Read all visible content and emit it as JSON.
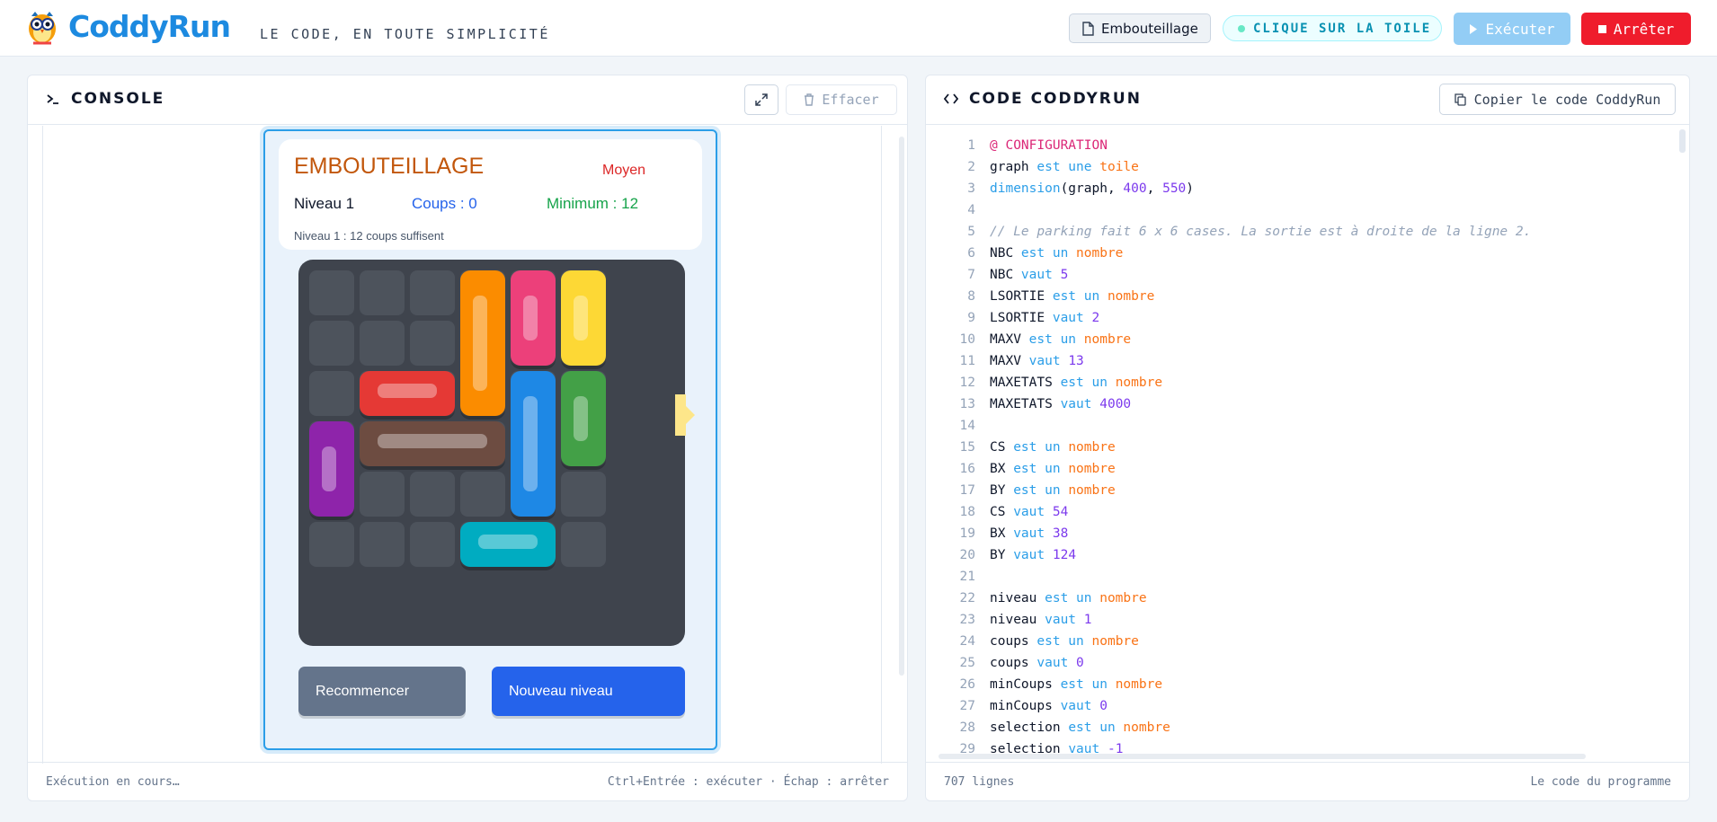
{
  "app": {
    "name": "CoddyRun",
    "tagline": "LE CODE, EN TOUTE SIMPLICITÉ"
  },
  "header": {
    "file_label": "Embouteillage",
    "hint": "CLIQUE SUR LA TOILE",
    "run_label": "Exécuter",
    "stop_label": "Arrêter"
  },
  "console": {
    "title": "CONSOLE",
    "clear_label": "Effacer",
    "status": "Exécution en cours…",
    "shortcuts": "Ctrl+Entrée : exécuter · Échap : arrêter"
  },
  "game": {
    "title": "EMBOUTEILLAGE",
    "difficulty": "Moyen",
    "level": "Niveau 1",
    "moves": "Coups : 0",
    "minimum": "Minimum : 12",
    "subtitle": "Niveau 1 : 12 coups suffisent",
    "restart_label": "Recommencer",
    "new_level_label": "Nouveau niveau",
    "grid": {
      "rows": 6,
      "cols": 6,
      "exit_row": 2
    },
    "cars": [
      {
        "name": "orange",
        "color": "#fb8c00",
        "row": 0,
        "col": 3,
        "orientation": "vertical",
        "length": 3
      },
      {
        "name": "pink",
        "color": "#ec407a",
        "row": 0,
        "col": 4,
        "orientation": "vertical",
        "length": 2
      },
      {
        "name": "yellow",
        "color": "#fdd835",
        "row": 0,
        "col": 5,
        "orientation": "vertical",
        "length": 2
      },
      {
        "name": "red",
        "color": "#e53935",
        "row": 2,
        "col": 1,
        "orientation": "horizontal",
        "length": 2
      },
      {
        "name": "blue",
        "color": "#1e88e5",
        "row": 2,
        "col": 4,
        "orientation": "vertical",
        "length": 3
      },
      {
        "name": "green",
        "color": "#43a047",
        "row": 2,
        "col": 5,
        "orientation": "vertical",
        "length": 2
      },
      {
        "name": "purple",
        "color": "#8e24aa",
        "row": 3,
        "col": 0,
        "orientation": "vertical",
        "length": 2
      },
      {
        "name": "brown",
        "color": "#6d4c41",
        "row": 3,
        "col": 1,
        "orientation": "horizontal",
        "length": 3
      },
      {
        "name": "cyan",
        "color": "#00acc1",
        "row": 5,
        "col": 3,
        "orientation": "horizontal",
        "length": 2
      }
    ]
  },
  "code_panel": {
    "title": "CODE CODDYRUN",
    "copy_label": "Copier le code CoddyRun",
    "line_count": "707 lignes",
    "footer_right": "Le code du programme"
  },
  "code_lines": [
    [
      {
        "t": "@ CONFIGURATION",
        "c": "an"
      }
    ],
    [
      {
        "t": "graph ",
        "c": ""
      },
      {
        "t": "est une ",
        "c": "kw"
      },
      {
        "t": "toile",
        "c": "ty"
      }
    ],
    [
      {
        "t": "dimension",
        "c": "fn"
      },
      {
        "t": "(graph, ",
        "c": ""
      },
      {
        "t": "400",
        "c": "nu"
      },
      {
        "t": ", ",
        "c": ""
      },
      {
        "t": "550",
        "c": "nu"
      },
      {
        "t": ")",
        "c": ""
      }
    ],
    [],
    [
      {
        "t": "// Le parking fait 6 x 6 cases. La sortie est à droite de la ligne 2.",
        "c": "cm"
      }
    ],
    [
      {
        "t": "NBC ",
        "c": ""
      },
      {
        "t": "est un ",
        "c": "kw"
      },
      {
        "t": "nombre",
        "c": "ty"
      }
    ],
    [
      {
        "t": "NBC ",
        "c": ""
      },
      {
        "t": "vaut ",
        "c": "kw"
      },
      {
        "t": "5",
        "c": "nu"
      }
    ],
    [
      {
        "t": "LSORTIE ",
        "c": ""
      },
      {
        "t": "est un ",
        "c": "kw"
      },
      {
        "t": "nombre",
        "c": "ty"
      }
    ],
    [
      {
        "t": "LSORTIE ",
        "c": ""
      },
      {
        "t": "vaut ",
        "c": "kw"
      },
      {
        "t": "2",
        "c": "nu"
      }
    ],
    [
      {
        "t": "MAXV ",
        "c": ""
      },
      {
        "t": "est un ",
        "c": "kw"
      },
      {
        "t": "nombre",
        "c": "ty"
      }
    ],
    [
      {
        "t": "MAXV ",
        "c": ""
      },
      {
        "t": "vaut ",
        "c": "kw"
      },
      {
        "t": "13",
        "c": "nu"
      }
    ],
    [
      {
        "t": "MAXETATS ",
        "c": ""
      },
      {
        "t": "est un ",
        "c": "kw"
      },
      {
        "t": "nombre",
        "c": "ty"
      }
    ],
    [
      {
        "t": "MAXETATS ",
        "c": ""
      },
      {
        "t": "vaut ",
        "c": "kw"
      },
      {
        "t": "4000",
        "c": "nu"
      }
    ],
    [],
    [
      {
        "t": "CS ",
        "c": ""
      },
      {
        "t": "est un ",
        "c": "kw"
      },
      {
        "t": "nombre",
        "c": "ty"
      }
    ],
    [
      {
        "t": "BX ",
        "c": ""
      },
      {
        "t": "est un ",
        "c": "kw"
      },
      {
        "t": "nombre",
        "c": "ty"
      }
    ],
    [
      {
        "t": "BY ",
        "c": ""
      },
      {
        "t": "est un ",
        "c": "kw"
      },
      {
        "t": "nombre",
        "c": "ty"
      }
    ],
    [
      {
        "t": "CS ",
        "c": ""
      },
      {
        "t": "vaut ",
        "c": "kw"
      },
      {
        "t": "54",
        "c": "nu"
      }
    ],
    [
      {
        "t": "BX ",
        "c": ""
      },
      {
        "t": "vaut ",
        "c": "kw"
      },
      {
        "t": "38",
        "c": "nu"
      }
    ],
    [
      {
        "t": "BY ",
        "c": ""
      },
      {
        "t": "vaut ",
        "c": "kw"
      },
      {
        "t": "124",
        "c": "nu"
      }
    ],
    [],
    [
      {
        "t": "niveau ",
        "c": ""
      },
      {
        "t": "est un ",
        "c": "kw"
      },
      {
        "t": "nombre",
        "c": "ty"
      }
    ],
    [
      {
        "t": "niveau ",
        "c": ""
      },
      {
        "t": "vaut ",
        "c": "kw"
      },
      {
        "t": "1",
        "c": "nu"
      }
    ],
    [
      {
        "t": "coups ",
        "c": ""
      },
      {
        "t": "est un ",
        "c": "kw"
      },
      {
        "t": "nombre",
        "c": "ty"
      }
    ],
    [
      {
        "t": "coups ",
        "c": ""
      },
      {
        "t": "vaut ",
        "c": "kw"
      },
      {
        "t": "0",
        "c": "nu"
      }
    ],
    [
      {
        "t": "minCoups ",
        "c": ""
      },
      {
        "t": "est un ",
        "c": "kw"
      },
      {
        "t": "nombre",
        "c": "ty"
      }
    ],
    [
      {
        "t": "minCoups ",
        "c": ""
      },
      {
        "t": "vaut ",
        "c": "kw"
      },
      {
        "t": "0",
        "c": "nu"
      }
    ],
    [
      {
        "t": "selection ",
        "c": ""
      },
      {
        "t": "est un ",
        "c": "kw"
      },
      {
        "t": "nombre",
        "c": "ty"
      }
    ],
    [
      {
        "t": "selection ",
        "c": ""
      },
      {
        "t": "vaut ",
        "c": "kw"
      },
      {
        "t": "-1",
        "c": "nu"
      }
    ]
  ]
}
